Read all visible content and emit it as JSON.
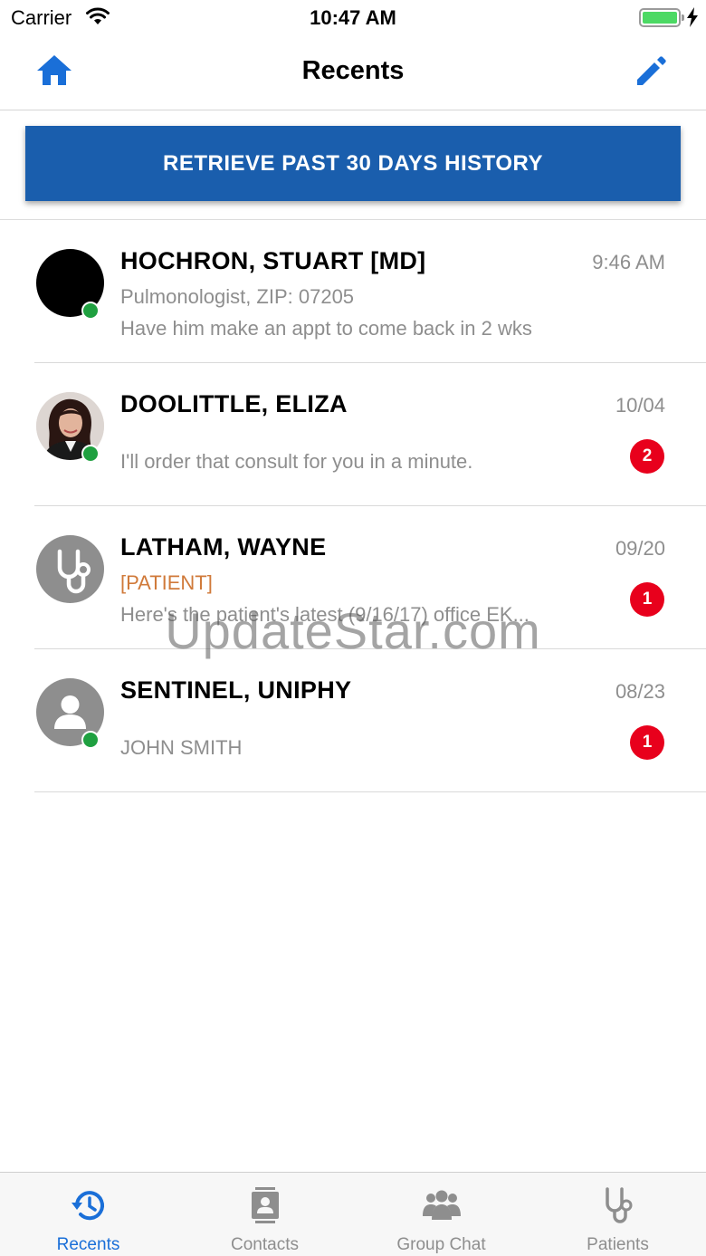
{
  "status_bar": {
    "carrier": "Carrier",
    "time": "10:47 AM",
    "battery_icon": "battery-charging-icon"
  },
  "nav": {
    "title": "Recents",
    "left_icon": "home-icon",
    "right_icon": "edit-pencil-icon",
    "accent": "#1a6fd8"
  },
  "history_button": {
    "label": "RETRIEVE PAST 30 DAYS HISTORY",
    "color": "#1a5ead"
  },
  "conversations": [
    {
      "name": "HOCHRON, STUART [MD]",
      "time": "9:46 AM",
      "subtitle": "Pulmonologist, ZIP: 07205",
      "message": "Have him make an appt to come back in 2 wks",
      "online": true,
      "unread": ""
    },
    {
      "name": "DOOLITTLE, ELIZA",
      "time": "10/04",
      "subtitle": "",
      "message": "I'll order that consult for you in a minute.",
      "online": true,
      "unread": "2"
    },
    {
      "name": "LATHAM, WAYNE",
      "time": "09/20",
      "subtitle": "[PATIENT]",
      "message": "Here's the patient's latest (9/16/17) office EK...",
      "online": false,
      "unread": "1"
    },
    {
      "name": "SENTINEL, UNIPHY",
      "time": "08/23",
      "subtitle": "",
      "message": "JOHN SMITH",
      "online": true,
      "unread": "1"
    }
  ],
  "watermark": "UpdateStar.com",
  "tabs": [
    {
      "label": "Recents",
      "icon": "history-icon",
      "active": true
    },
    {
      "label": "Contacts",
      "icon": "contacts-icon",
      "active": false
    },
    {
      "label": "Group Chat",
      "icon": "group-icon",
      "active": false
    },
    {
      "label": "Patients",
      "icon": "stethoscope-icon",
      "active": false
    }
  ]
}
